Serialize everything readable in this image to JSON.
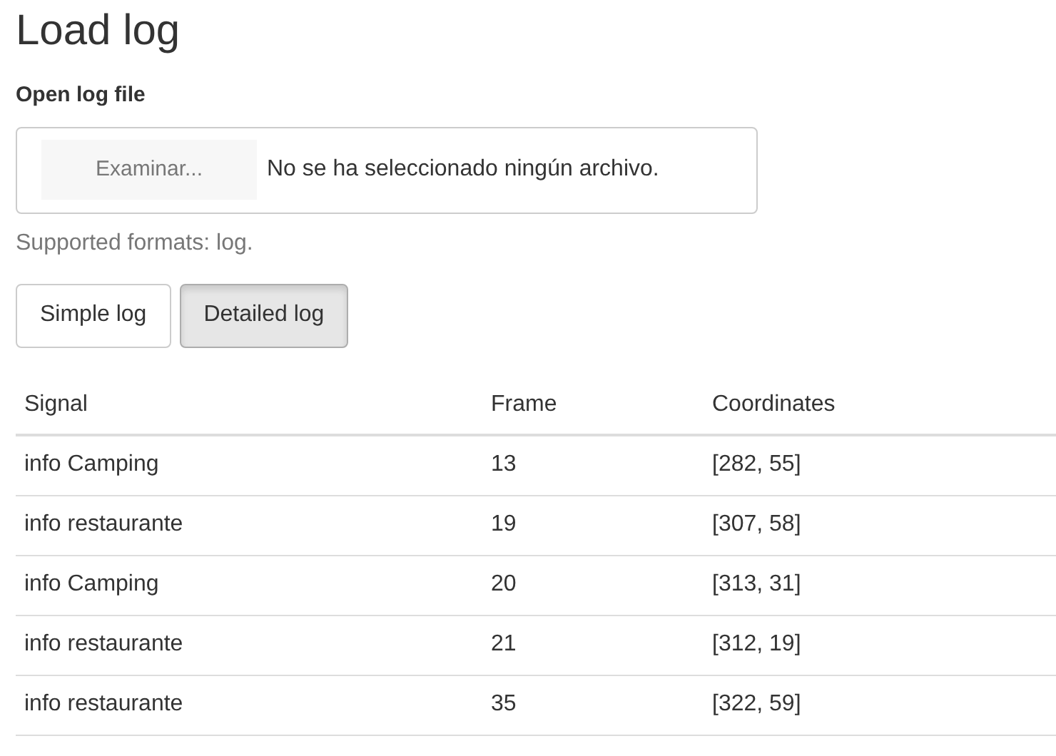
{
  "title": "Load log",
  "file_input": {
    "label": "Open log file",
    "button": "Examinar...",
    "status": "No se ha seleccionado ningún archivo.",
    "help": "Supported formats: log."
  },
  "view_buttons": [
    {
      "label": "Simple log",
      "selected": false
    },
    {
      "label": "Detailed log",
      "selected": true
    }
  ],
  "table": {
    "columns": [
      "Signal",
      "Frame",
      "Coordinates"
    ],
    "rows": [
      [
        "info Camping",
        "13",
        "[282, 55]"
      ],
      [
        "info restaurante",
        "19",
        "[307, 58]"
      ],
      [
        "info Camping",
        "20",
        "[313, 31]"
      ],
      [
        "info restaurante",
        "21",
        "[312, 19]"
      ],
      [
        "info restaurante",
        "35",
        "[322, 59]"
      ]
    ]
  }
}
